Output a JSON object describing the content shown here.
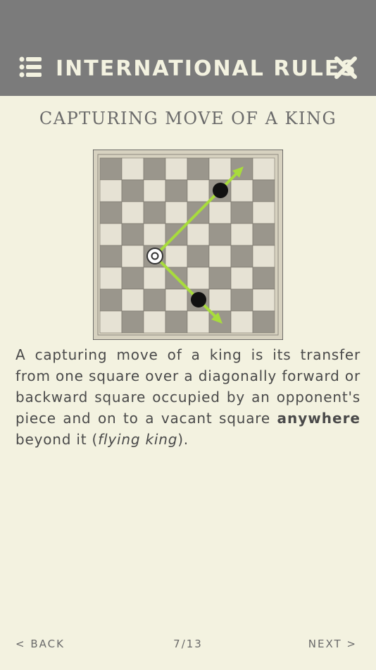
{
  "header": {
    "title": "INTERNATIONAL RULES",
    "icons": {
      "menu": "list-menu-icon",
      "close": "close-x-icon"
    }
  },
  "section": {
    "heading": "CAPTURING MOVE OF A KING"
  },
  "diagram": {
    "board": "8x8 checkerboard",
    "king": "white king (ring piece)",
    "opponent_pieces": [
      "black piece",
      "black piece"
    ],
    "arrows": [
      "forward-right capture path",
      "backward-right capture path"
    ],
    "colors": {
      "light_square": "#e6e2d4",
      "dark_square": "#9a968c",
      "arrow": "#a8dc3c",
      "frame": "#d7d2c0"
    }
  },
  "description": {
    "part1": "A capturing move of a king is its transfer from one square over a diagonally forward or backward square occupied by an opponent's piece and on to a vacant square ",
    "bold": "anywhere",
    "part2": " beyond it (",
    "italic": "flying king",
    "part3": ")."
  },
  "footer": {
    "back_label": "< BACK",
    "page_indicator": "7/13",
    "next_label": "NEXT >"
  }
}
